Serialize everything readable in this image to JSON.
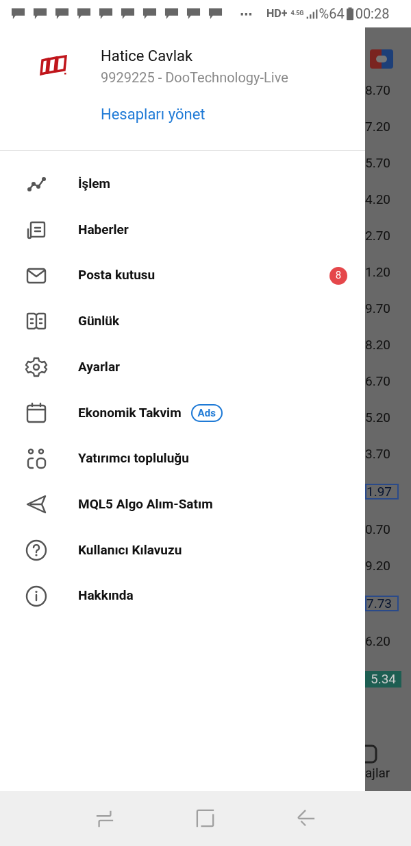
{
  "status_bar": {
    "notifications": [
      {
        "kind": "message"
      },
      {
        "kind": "message"
      },
      {
        "kind": "message"
      },
      {
        "kind": "message"
      },
      {
        "kind": "message"
      },
      {
        "kind": "message"
      },
      {
        "kind": "message"
      },
      {
        "kind": "message"
      },
      {
        "kind": "message"
      },
      {
        "kind": "message"
      }
    ],
    "more": "⋯",
    "network": "HD+",
    "data_type": "4.5G",
    "battery": "%64",
    "time": "00:28"
  },
  "account": {
    "name": "Hatice Cavlak",
    "details": "9929225 - DooTechnology-Live",
    "manage_link": "Hesapları yönet"
  },
  "menu": [
    {
      "kind": "chart",
      "label": "İşlem"
    },
    {
      "kind": "news",
      "label": "Haberler"
    },
    {
      "kind": "mail",
      "label": "Posta kutusu",
      "badge": "8"
    },
    {
      "kind": "journal",
      "label": "Günlük"
    },
    {
      "kind": "settings",
      "label": "Ayarlar"
    },
    {
      "kind": "calendar",
      "label": "Ekonomik Takvim",
      "tag": "Ads"
    },
    {
      "kind": "community",
      "label": "Yatırımcı topluluğu"
    },
    {
      "kind": "send",
      "label": "MQL5 Algo Alım-Satım"
    },
    {
      "kind": "help",
      "label": "Kullanıcı Kılavuzu"
    },
    {
      "kind": "info",
      "label": "Hakkında"
    }
  ],
  "background": {
    "price_labels": [
      {
        "text": "8.70",
        "kind": "plain"
      },
      {
        "text": "7.20",
        "kind": "plain"
      },
      {
        "text": "5.70",
        "kind": "plain"
      },
      {
        "text": "4.20",
        "kind": "plain"
      },
      {
        "text": "2.70",
        "kind": "plain"
      },
      {
        "text": "1.20",
        "kind": "plain"
      },
      {
        "text": "9.70",
        "kind": "plain"
      },
      {
        "text": "8.20",
        "kind": "plain"
      },
      {
        "text": "6.70",
        "kind": "plain"
      },
      {
        "text": "5.20",
        "kind": "plain"
      },
      {
        "text": "3.70",
        "kind": "plain"
      },
      {
        "text": "1.97",
        "kind": "boxed"
      },
      {
        "text": "0.70",
        "kind": "plain"
      },
      {
        "text": "9.20",
        "kind": "plain"
      },
      {
        "text": "7.73",
        "kind": "boxed"
      },
      {
        "text": "6.20",
        "kind": "plain"
      },
      {
        "text": "5.34",
        "kind": "bid"
      }
    ],
    "tab_label": "ajlar"
  }
}
